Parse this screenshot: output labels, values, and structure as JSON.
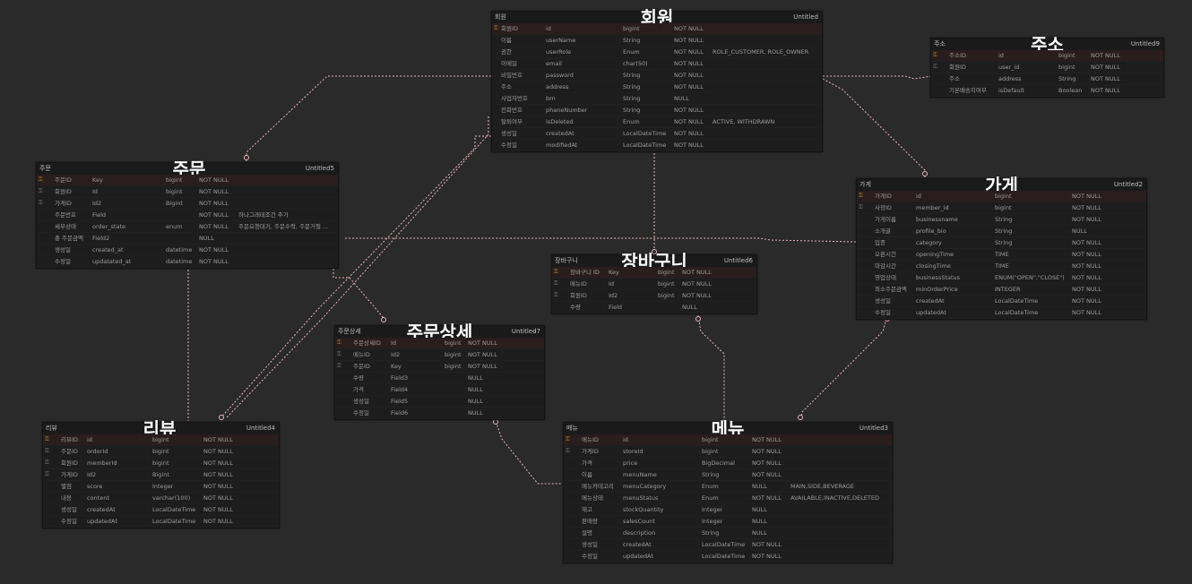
{
  "entities": {
    "member": {
      "logical": "회원",
      "title": "회원",
      "table": "Untitled",
      "rows": [
        {
          "logical": "회원ID",
          "physical": "id",
          "type": "bigint",
          "null": "NOT NULL",
          "comment": "",
          "pk": true
        },
        {
          "logical": "이름",
          "physical": "userName",
          "type": "String",
          "null": "NOT NULL",
          "comment": "",
          "pk": false
        },
        {
          "logical": "권한",
          "physical": "userRole",
          "type": "Enum",
          "null": "NOT NULL",
          "comment": "ROLE_CUSTOMER, ROLE_OWNER",
          "pk": false
        },
        {
          "logical": "이메일",
          "physical": "email",
          "type": "char(50)",
          "null": "NOT NULL",
          "comment": "",
          "pk": false
        },
        {
          "logical": "비밀번호",
          "physical": "password",
          "type": "String",
          "null": "NOT NULL",
          "comment": "",
          "pk": false
        },
        {
          "logical": "주소",
          "physical": "address",
          "type": "String",
          "null": "NOT NULL",
          "comment": "",
          "pk": false
        },
        {
          "logical": "사업자번호",
          "physical": "brn",
          "type": "String",
          "null": "NULL",
          "comment": "",
          "pk": false
        },
        {
          "logical": "전화번호",
          "physical": "phaneNumber",
          "type": "String",
          "null": "NOT NULL",
          "comment": "",
          "pk": false
        },
        {
          "logical": "탈퇴여부",
          "physical": "isDeleted",
          "type": "Enum",
          "null": "NOT NULL",
          "comment": "ACTIVE, WITHDRAWN",
          "pk": false
        },
        {
          "logical": "생성일",
          "physical": "createdAt",
          "type": "LocalDateTime",
          "null": "NOT NULL",
          "comment": "",
          "pk": false
        },
        {
          "logical": "수정일",
          "physical": "modifiedAt",
          "type": "LocalDateTime",
          "null": "NOT NULL",
          "comment": "",
          "pk": false
        }
      ]
    },
    "address": {
      "logical": "주소",
      "title": "주소",
      "table": "Untitled9",
      "rows": [
        {
          "logical": "주소ID",
          "physical": "id",
          "type": "bigint",
          "null": "NOT NULL",
          "comment": "",
          "pk": true
        },
        {
          "logical": "회원ID",
          "physical": "user_id",
          "type": "bigint",
          "null": "NOT NULL",
          "comment": "",
          "pk": false
        },
        {
          "logical": "주소",
          "physical": "address",
          "type": "String",
          "null": "NOT NULL",
          "comment": "",
          "pk": false
        },
        {
          "logical": "기본배송지여부",
          "physical": "isDefault",
          "type": "Boolean",
          "null": "NOT NULL",
          "comment": "",
          "pk": false
        }
      ]
    },
    "order": {
      "logical": "주문",
      "title": "주문",
      "table": "Untitled5",
      "rows": [
        {
          "logical": "주문ID",
          "physical": "Key",
          "type": "bigint",
          "null": "NOT NULL",
          "comment": "",
          "pk": true
        },
        {
          "logical": "회원ID",
          "physical": "Id",
          "type": "bigint",
          "null": "NOT NULL",
          "comment": "",
          "pk": false
        },
        {
          "logical": "가게ID",
          "physical": "Id2",
          "type": "Bigint",
          "null": "NOT NULL",
          "comment": "",
          "pk": false
        },
        {
          "logical": "주문번호",
          "physical": "Field",
          "type": "",
          "null": "NOT NULL",
          "comment": "하나그래데조건 추가",
          "pk": false
        },
        {
          "logical": "세부상태",
          "physical": "order_state",
          "type": "enum",
          "null": "NOT NULL",
          "comment": "주문요청대기, 주문수락, 주문거절 ...",
          "pk": false
        },
        {
          "logical": "총 주문금액",
          "physical": "Field2",
          "type": "",
          "null": "NULL",
          "comment": "",
          "pk": false
        },
        {
          "logical": "생성일",
          "physical": "created_at",
          "type": "datetime",
          "null": "NOT NULL",
          "comment": "",
          "pk": false
        },
        {
          "logical": "수정일",
          "physical": "updatated_at",
          "type": "datetime",
          "null": "NOT NULL",
          "comment": "",
          "pk": false
        }
      ]
    },
    "store": {
      "logical": "가게",
      "title": "가게",
      "table": "Untitled2",
      "rows": [
        {
          "logical": "가게ID",
          "physical": "id",
          "type": "bigint",
          "null": "NOT NULL",
          "comment": "",
          "pk": true
        },
        {
          "logical": "사장ID",
          "physical": "member_id",
          "type": "bigint",
          "null": "NOT NULL",
          "comment": "",
          "pk": false
        },
        {
          "logical": "가게이름",
          "physical": "businessname",
          "type": "String",
          "null": "NOT NULL",
          "comment": "",
          "pk": false
        },
        {
          "logical": "소개글",
          "physical": "profile_bio",
          "type": "String",
          "null": "NULL",
          "comment": "",
          "pk": false
        },
        {
          "logical": "업종",
          "physical": "category",
          "type": "String",
          "null": "NOT NULL",
          "comment": "",
          "pk": false
        },
        {
          "logical": "오픈시간",
          "physical": "openingTime",
          "type": "TIME",
          "null": "NOT NULL",
          "comment": "",
          "pk": false
        },
        {
          "logical": "마감시간",
          "physical": "closingTime",
          "type": "TIME",
          "null": "NOT NULL",
          "comment": "",
          "pk": false
        },
        {
          "logical": "영업상태",
          "physical": "businessStatus",
          "type": "ENUM(\"OPEN\",\"CLOSE\")",
          "null": "NOT NULL",
          "comment": "",
          "pk": false
        },
        {
          "logical": "최소주문금액",
          "physical": "minOrderPrice",
          "type": "INTEGER",
          "null": "NOT NULL",
          "comment": "",
          "pk": false
        },
        {
          "logical": "생성일",
          "physical": "createdAt",
          "type": "LocalDateTime",
          "null": "NOT NULL",
          "comment": "",
          "pk": false
        },
        {
          "logical": "수정일",
          "physical": "updatedAt",
          "type": "LocalDateTime",
          "null": "NOT NULL",
          "comment": "",
          "pk": false
        }
      ]
    },
    "cart": {
      "logical": "장바구니",
      "title": "장바구니",
      "table": "Untitled6",
      "rows": [
        {
          "logical": "장바구니 ID",
          "physical": "Key",
          "type": "bigint",
          "null": "NOT NULL",
          "comment": "",
          "pk": true
        },
        {
          "logical": "메뉴ID",
          "physical": "Id",
          "type": "bigint",
          "null": "NOT NULL",
          "comment": "",
          "pk": false
        },
        {
          "logical": "회원ID",
          "physical": "Id2",
          "type": "bigint",
          "null": "NOT NULL",
          "comment": "",
          "pk": false
        },
        {
          "logical": "수량",
          "physical": "Field",
          "type": "",
          "null": "NULL",
          "comment": "",
          "pk": false
        }
      ]
    },
    "order_detail": {
      "logical": "주문상세",
      "title": "주문상세",
      "table": "Untitled7",
      "rows": [
        {
          "logical": "주문상세ID",
          "physical": "Id",
          "type": "bigint",
          "null": "NOT NULL",
          "comment": "",
          "pk": true
        },
        {
          "logical": "메뉴ID",
          "physical": "Id2",
          "type": "bigint",
          "null": "NOT NULL",
          "comment": "",
          "pk": false
        },
        {
          "logical": "주문ID",
          "physical": "Key",
          "type": "bigint",
          "null": "NOT NULL",
          "comment": "",
          "pk": false
        },
        {
          "logical": "수량",
          "physical": "Field3",
          "type": "",
          "null": "NULL",
          "comment": "",
          "pk": false
        },
        {
          "logical": "가격",
          "physical": "Field4",
          "type": "",
          "null": "NULL",
          "comment": "",
          "pk": false
        },
        {
          "logical": "생성일",
          "physical": "Field5",
          "type": "",
          "null": "NULL",
          "comment": "",
          "pk": false
        },
        {
          "logical": "수정일",
          "physical": "Field6",
          "type": "",
          "null": "NULL",
          "comment": "",
          "pk": false
        }
      ]
    },
    "review": {
      "logical": "리뷰",
      "title": "리뷰",
      "table": "Untitled4",
      "rows": [
        {
          "logical": "리뷰ID",
          "physical": "id",
          "type": "bigint",
          "null": "NOT NULL",
          "comment": "",
          "pk": true
        },
        {
          "logical": "주문ID",
          "physical": "orderId",
          "type": "bigint",
          "null": "NOT NULL",
          "comment": "",
          "pk": false
        },
        {
          "logical": "회원ID",
          "physical": "memberId",
          "type": "bigint",
          "null": "NOT NULL",
          "comment": "",
          "pk": false
        },
        {
          "logical": "가게ID",
          "physical": "Id2",
          "type": "Bigint",
          "null": "NOT NULL",
          "comment": "",
          "pk": false
        },
        {
          "logical": "별점",
          "physical": "score",
          "type": "Integer",
          "null": "NOT NULL",
          "comment": "",
          "pk": false
        },
        {
          "logical": "내용",
          "physical": "content",
          "type": "varchar(100)",
          "null": "NOT NULL",
          "comment": "",
          "pk": false
        },
        {
          "logical": "생성일",
          "physical": "createdAt",
          "type": "LocalDateTime",
          "null": "NOT NULL",
          "comment": "",
          "pk": false
        },
        {
          "logical": "수정일",
          "physical": "updatedAt",
          "type": "LocalDateTime",
          "null": "NOT NULL",
          "comment": "",
          "pk": false
        }
      ]
    },
    "menu": {
      "logical": "메뉴",
      "title": "메뉴",
      "table": "Untitled3",
      "rows": [
        {
          "logical": "메뉴ID",
          "physical": "id",
          "type": "bigint",
          "null": "NOT NULL",
          "comment": "",
          "pk": true
        },
        {
          "logical": "가게ID",
          "physical": "storeId",
          "type": "bigint",
          "null": "NOT NULL",
          "comment": "",
          "pk": false
        },
        {
          "logical": "가격",
          "physical": "price",
          "type": "BigDecimal",
          "null": "NOT NULL",
          "comment": "",
          "pk": false
        },
        {
          "logical": "이름",
          "physical": "menuName",
          "type": "String",
          "null": "NOT NULL",
          "comment": "",
          "pk": false
        },
        {
          "logical": "메뉴카테고리",
          "physical": "menuCategory",
          "type": "Enum",
          "null": "NULL",
          "comment": "MAIN,SIDE,BEVERAGE",
          "pk": false
        },
        {
          "logical": "메뉴상태",
          "physical": "menuStatus",
          "type": "Enum",
          "null": "NOT NULL",
          "comment": "AVAILABLE,INACTIVE,DELETED",
          "pk": false
        },
        {
          "logical": "재고",
          "physical": "stockQuantity",
          "type": "Integer",
          "null": "NULL",
          "comment": "",
          "pk": false
        },
        {
          "logical": "판매량",
          "physical": "salesCount",
          "type": "Integer",
          "null": "NULL",
          "comment": "",
          "pk": false
        },
        {
          "logical": "설명",
          "physical": "description",
          "type": "String",
          "null": "NULL",
          "comment": "",
          "pk": false
        },
        {
          "logical": "생성일",
          "physical": "createdAt",
          "type": "LocalDateTime",
          "null": "NOT NULL",
          "comment": "",
          "pk": false
        },
        {
          "logical": "수정일",
          "physical": "updatedAt",
          "type": "LocalDateTime",
          "null": "NOT NULL",
          "comment": "",
          "pk": false
        }
      ]
    }
  },
  "icons": {
    "key": "key-icon",
    "fk": "foreign-key-icon"
  },
  "colors": {
    "line": "#e8b4bc",
    "background": "#2a2a2a",
    "entity": "#1d1d1d",
    "key": "#b08a2e"
  }
}
